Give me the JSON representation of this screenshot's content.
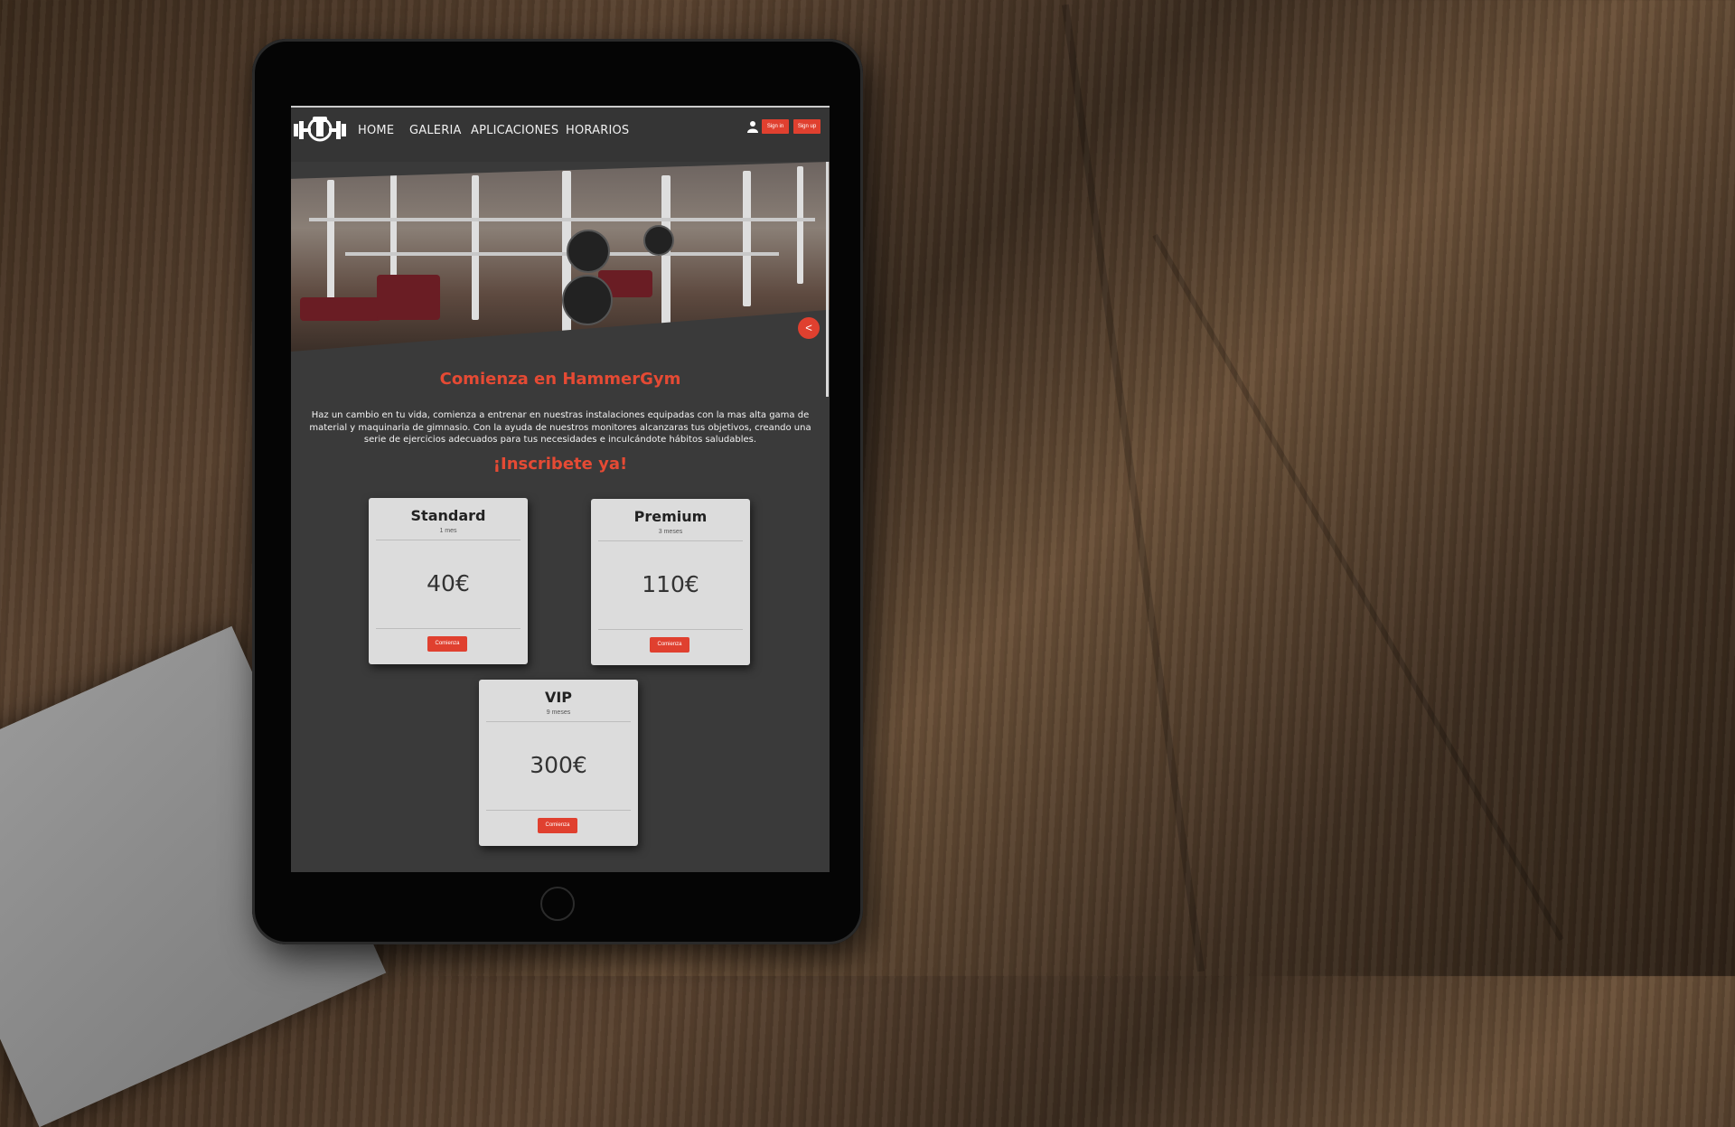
{
  "navbar": {
    "items": [
      "HOME",
      "GALERIA",
      "APLICACIONES",
      "HORARIOS"
    ],
    "signin_label": "Sign in",
    "signup_label": "Sign up"
  },
  "carousel": {
    "prev_label": "<"
  },
  "main": {
    "heading": "Comienza en HammerGym",
    "intro": "Haz un cambio en tu vida, comienza a entrenar en nuestras instalaciones equipadas con la mas alta gama de material y maquinaria de gimnasio. Con la ayuda de nuestros monitores alcanzaras tus objetivos, creando una serie de ejercicios adecuados para tus necesidades e inculcándote hábitos saludables.",
    "subheading": "¡Inscribete ya!"
  },
  "plans": [
    {
      "name": "Standard",
      "period": "1 mes",
      "price": "40€",
      "button": "Comienza"
    },
    {
      "name": "Premium",
      "period": "3 meses",
      "price": "110€",
      "button": "Comienza"
    },
    {
      "name": "VIP",
      "period": "9 meses",
      "price": "300€",
      "button": "Comienza"
    }
  ],
  "colors": {
    "accent": "#e0402f",
    "page_bg": "#3a3a3a",
    "card_bg": "#dcdcdc"
  }
}
